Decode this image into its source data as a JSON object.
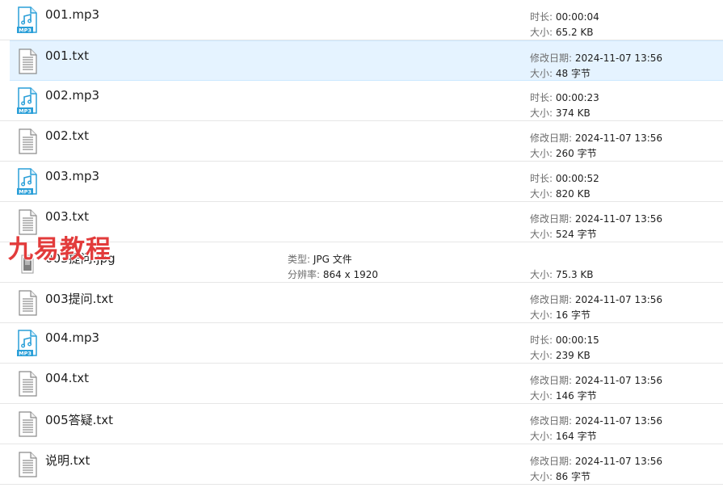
{
  "files": [
    {
      "name": "001.mp3",
      "type": "mp3",
      "icon": "mp3-file-icon",
      "meta": [
        {
          "k": "时长:",
          "v": "00:00:04"
        },
        {
          "k": "大小:",
          "v": "65.2 KB"
        }
      ]
    },
    {
      "name": "001.txt",
      "type": "txt",
      "icon": "text-file-icon",
      "selected": true,
      "meta": [
        {
          "k": "修改日期:",
          "v": "2024-11-07 13:56"
        },
        {
          "k": "大小:",
          "v": "48 字节"
        }
      ]
    },
    {
      "name": "002.mp3",
      "type": "mp3",
      "icon": "mp3-file-icon",
      "meta": [
        {
          "k": "时长:",
          "v": "00:00:23"
        },
        {
          "k": "大小:",
          "v": "374 KB"
        }
      ]
    },
    {
      "name": "002.txt",
      "type": "txt",
      "icon": "text-file-icon",
      "meta": [
        {
          "k": "修改日期:",
          "v": "2024-11-07 13:56"
        },
        {
          "k": "大小:",
          "v": "260 字节"
        }
      ]
    },
    {
      "name": "003.mp3",
      "type": "mp3",
      "icon": "mp3-file-icon",
      "meta": [
        {
          "k": "时长:",
          "v": "00:00:52"
        },
        {
          "k": "大小:",
          "v": "820 KB"
        }
      ]
    },
    {
      "name": "003.txt",
      "type": "txt",
      "icon": "text-file-icon",
      "meta": [
        {
          "k": "修改日期:",
          "v": "2024-11-07 13:56"
        },
        {
          "k": "大小:",
          "v": "524 字节"
        }
      ]
    },
    {
      "name": "003提问.jpg",
      "type": "jpg",
      "icon": "image-file-icon",
      "mid": [
        {
          "k": "类型:",
          "v": "JPG 文件"
        },
        {
          "k": "分辨率:",
          "v": "864 x 1920"
        }
      ],
      "meta": [
        {
          "k": "",
          "v": ""
        },
        {
          "k": "大小:",
          "v": "75.3 KB"
        }
      ]
    },
    {
      "name": "003提问.txt",
      "type": "txt",
      "icon": "text-file-icon",
      "meta": [
        {
          "k": "修改日期:",
          "v": "2024-11-07 13:56"
        },
        {
          "k": "大小:",
          "v": "16 字节"
        }
      ]
    },
    {
      "name": "004.mp3",
      "type": "mp3",
      "icon": "mp3-file-icon",
      "meta": [
        {
          "k": "时长:",
          "v": "00:00:15"
        },
        {
          "k": "大小:",
          "v": "239 KB"
        }
      ]
    },
    {
      "name": "004.txt",
      "type": "txt",
      "icon": "text-file-icon",
      "meta": [
        {
          "k": "修改日期:",
          "v": "2024-11-07 13:56"
        },
        {
          "k": "大小:",
          "v": "146 字节"
        }
      ]
    },
    {
      "name": "005答疑.txt",
      "type": "txt",
      "icon": "text-file-icon",
      "meta": [
        {
          "k": "修改日期:",
          "v": "2024-11-07 13:56"
        },
        {
          "k": "大小:",
          "v": "164 字节"
        }
      ]
    },
    {
      "name": "说明.txt",
      "type": "txt",
      "icon": "text-file-icon",
      "meta": [
        {
          "k": "修改日期:",
          "v": "2024-11-07 13:56"
        },
        {
          "k": "大小:",
          "v": "86 字节"
        }
      ]
    }
  ],
  "watermark": "九易教程",
  "colors": {
    "mp3_accent": "#2a9fd8",
    "selected_bg": "#e5f3ff",
    "watermark": "#e23b3b"
  }
}
